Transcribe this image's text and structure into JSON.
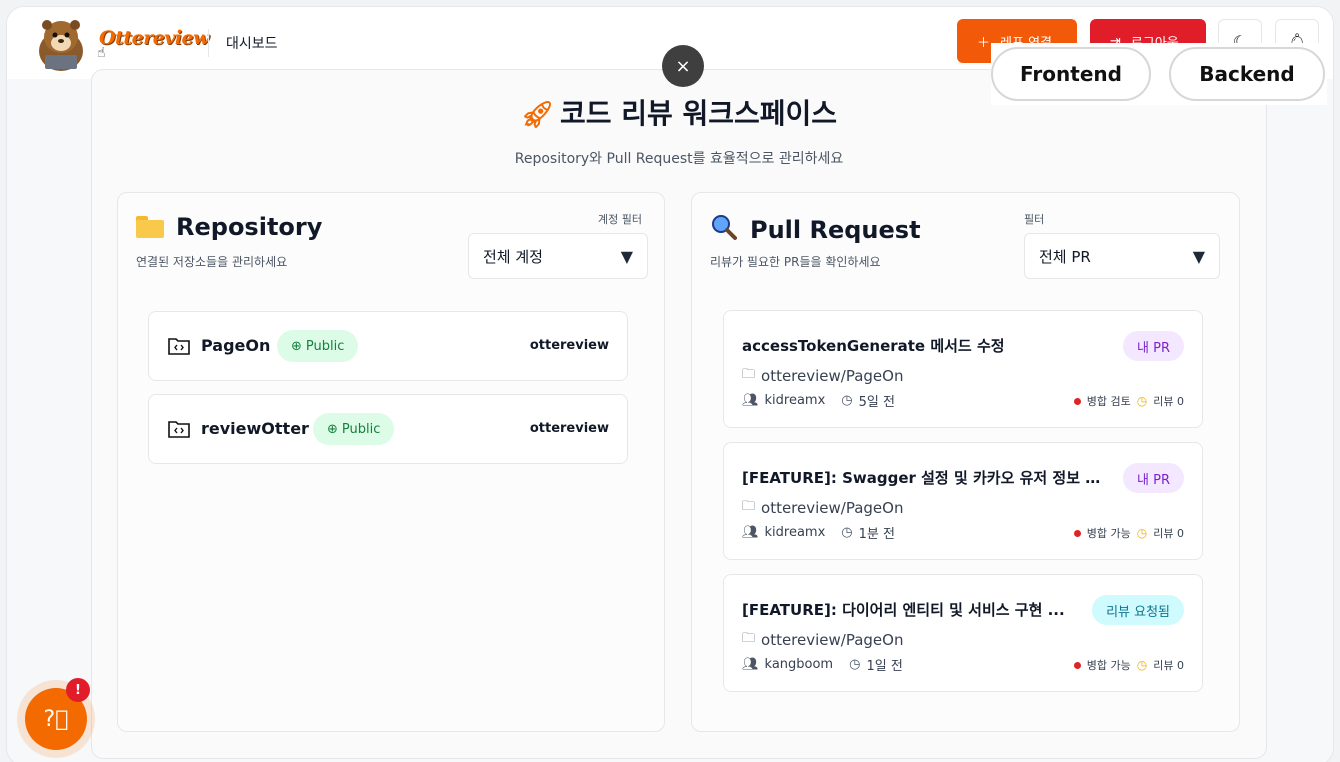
{
  "header": {
    "logo_text": "Ottereview",
    "nav_dashboard": "대시보드",
    "repo_connect_label": "레포 연결",
    "logout_label": "로그아웃"
  },
  "overlay": {
    "close_glyph": "×",
    "tabs": [
      {
        "label": "Frontend"
      },
      {
        "label": "Backend"
      }
    ]
  },
  "workspace": {
    "title": "코드 리뷰 워크스페이스",
    "subtitle": "Repository와 Pull Request를 효율적으로 관리하세요"
  },
  "repo_panel": {
    "title": "Repository",
    "description": "연결된 저장소들을 관리하세요",
    "filter_label": "계정 필터",
    "filter_value": "전체 계정",
    "repos": [
      {
        "name": "PageOn",
        "visibility": "Public",
        "owner": "ottereview"
      },
      {
        "name": "reviewOtter",
        "visibility": "Public",
        "owner": "ottereview"
      }
    ]
  },
  "pr_panel": {
    "title": "Pull Request",
    "description": "리뷰가 필요한 PR들을 확인하세요",
    "filter_label": "필터",
    "filter_value": "전체 PR",
    "prs": [
      {
        "title": "accessTokenGenerate 메서드 수정",
        "badge": "내 PR",
        "repo": "ottereview/PageOn",
        "author": "kidreamx",
        "time": "5일 전",
        "merge": "병합 검토",
        "reviews": "리뷰 0"
      },
      {
        "title": "[FEATURE]: Swagger 설정 및 카카오 유저 정보 수...",
        "badge": "내 PR",
        "repo": "ottereview/PageOn",
        "author": "kidreamx",
        "time": "1분 전",
        "merge": "병합 가능",
        "reviews": "리뷰 0"
      },
      {
        "title": "[FEATURE]: 다이어리 엔티티 및 서비스 구현 ...",
        "badge": "리뷰 요청됨",
        "repo": "ottereview/PageOn",
        "author": "kangboom",
        "time": "1일 전",
        "merge": "병합 가능",
        "reviews": "리뷰 0"
      }
    ]
  },
  "help": {
    "badge": "!"
  },
  "colors": {
    "brand": "#f26a00",
    "logout": "#e11d2a",
    "public_bg": "#dcfce7",
    "mine_bg": "#f3e8ff",
    "review_bg": "#cffafe"
  }
}
